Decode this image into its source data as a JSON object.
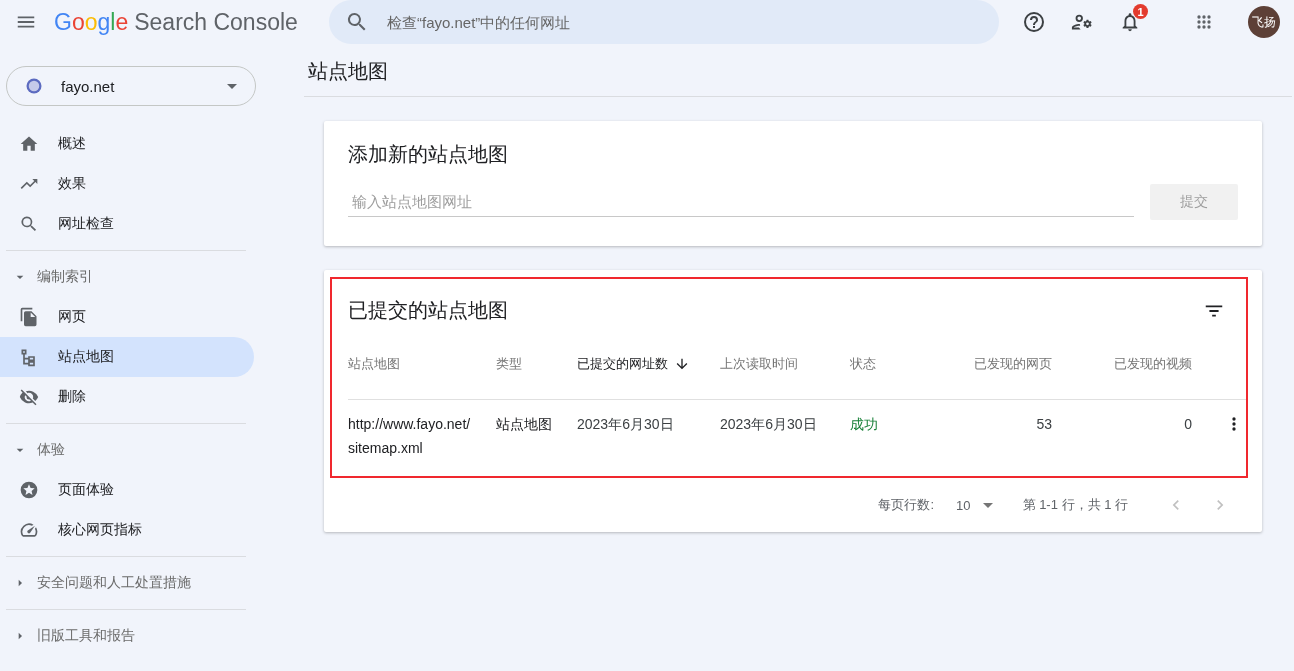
{
  "header": {
    "product": "Search Console",
    "logo_letters": [
      {
        "letter": "G",
        "color": "#4285f4"
      },
      {
        "letter": "o",
        "color": "#ea4335"
      },
      {
        "letter": "o",
        "color": "#fbbc05"
      },
      {
        "letter": "g",
        "color": "#4285f4"
      },
      {
        "letter": "l",
        "color": "#34a853"
      },
      {
        "letter": "e",
        "color": "#ea4335"
      }
    ],
    "search": {
      "placeholder": "检查“fayo.net”中的任何网址"
    },
    "notification_count": "1",
    "avatar": "飞扬"
  },
  "property": {
    "name": "fayo.net"
  },
  "nav": {
    "items": [
      {
        "label": "概述",
        "selected": false
      },
      {
        "label": "效果",
        "selected": false
      },
      {
        "label": "网址检查",
        "selected": false
      }
    ],
    "sections": [
      {
        "title": "编制索引",
        "expanded": true,
        "children": [
          {
            "label": "网页",
            "selected": false
          },
          {
            "label": "站点地图",
            "selected": true
          },
          {
            "label": "删除",
            "selected": false
          }
        ]
      },
      {
        "title": "体验",
        "expanded": true,
        "children": [
          {
            "label": "页面体验",
            "selected": false
          },
          {
            "label": "核心网页指标",
            "selected": false
          }
        ]
      },
      {
        "title": "安全问题和人工处置措施",
        "expanded": false
      },
      {
        "title": "旧版工具和报告",
        "expanded": false
      }
    ]
  },
  "page_title": "站点地图",
  "add_card": {
    "title": "添加新的站点地图",
    "placeholder": "输入站点地图网址",
    "submit": "提交",
    "submit_disabled": true
  },
  "submitted_card": {
    "title": "已提交的站点地图",
    "columns": [
      {
        "label": "站点地图",
        "sorted": false
      },
      {
        "label": "类型",
        "sorted": false
      },
      {
        "label": "已提交的网址数",
        "sorted": true
      },
      {
        "label": "上次读取时间",
        "sorted": false
      },
      {
        "label": "状态",
        "sorted": false
      },
      {
        "label": "已发现的网页",
        "sorted": false
      },
      {
        "label": "已发现的视频",
        "sorted": false
      }
    ],
    "rows": [
      {
        "cells": [
          "http://www.fayo.net/sitemap.xml",
          "站点地图",
          "2023年6月30日",
          "2023年6月30日",
          "成功",
          "53",
          "0"
        ],
        "status_ok": true
      }
    ],
    "pagination": {
      "rows_per_page_label": "每页行数:",
      "rows_per_page": "10",
      "range": "第 1-1 行，共 1 行"
    }
  }
}
